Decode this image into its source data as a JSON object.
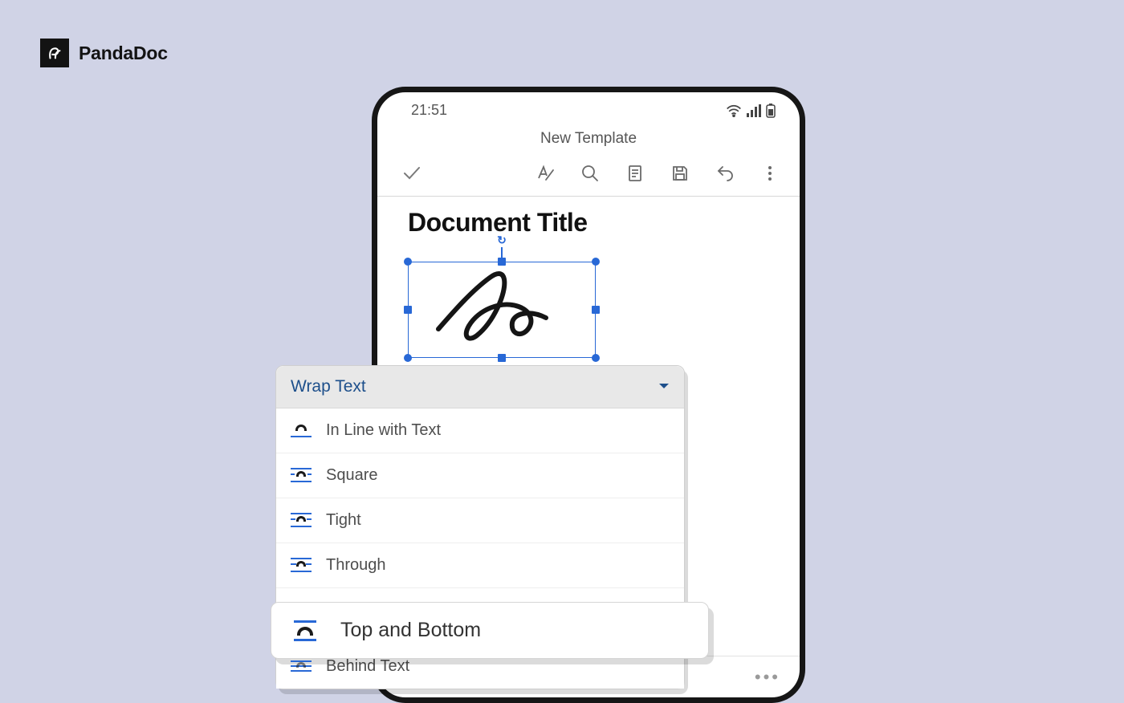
{
  "brand": {
    "name": "PandaDoc"
  },
  "statusbar": {
    "time": "21:51"
  },
  "header": {
    "doc_name": "New Template"
  },
  "document": {
    "heading": "Document Title"
  },
  "wrap_panel": {
    "title": "Wrap Text",
    "options": {
      "inline": "In Line with Text",
      "square": "Square",
      "tight": "Tight",
      "through": "Through",
      "top_bottom": "Top and Bottom",
      "behind": "Behind Text"
    }
  },
  "more": "•••"
}
